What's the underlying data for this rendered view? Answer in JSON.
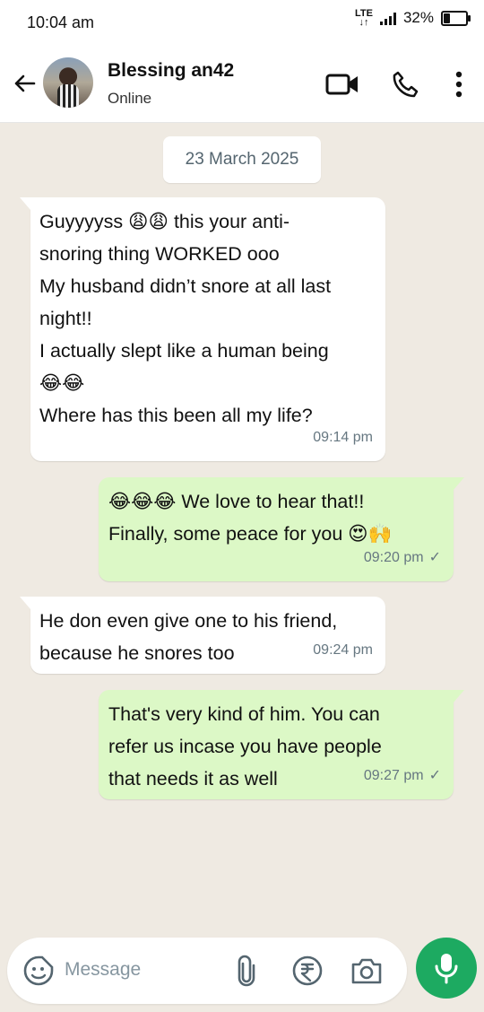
{
  "status_bar": {
    "time": "10:04 am",
    "network": "LTE",
    "battery": "32%",
    "battery_level": 0.32
  },
  "header": {
    "name": "Blessing an42",
    "status": "Online"
  },
  "date_chip": "23 March 2025",
  "messages": [
    {
      "dir": "in",
      "text": "Guyyyyss 😩😩 this your anti-\nsnoring thing WORKED ooo\nMy husband didn’t snore at all last\nnight!!\nI actually slept like a human being\n😂😂\nWhere has this been all my life?",
      "time": "09:14 pm"
    },
    {
      "dir": "out",
      "text": "😂😂😂 We love to hear that!!\nFinally, some peace for you 😍🙌",
      "time": "09:20 pm",
      "tick": "✓"
    },
    {
      "dir": "in",
      "text": "He don even give one to his friend,\nbecause he snores too",
      "time": "09:24 pm"
    },
    {
      "dir": "out",
      "text": "That's very kind of him. You can\nrefer us incase you have people\nthat needs it as well",
      "time": "09:27 pm",
      "tick": "✓"
    }
  ],
  "composer": {
    "placeholder": "Message"
  },
  "colors": {
    "accent": "#1daa61",
    "outgoing_bubble": "#dcf8c6",
    "incoming_bubble": "#ffffff",
    "chat_bg": "#efeae2"
  },
  "icons": [
    "back-arrow-icon",
    "video-call-icon",
    "phone-icon",
    "more-options-icon",
    "sticker-icon",
    "attach-icon",
    "rupee-payment-icon",
    "camera-icon",
    "mic-icon",
    "tick-icon"
  ]
}
